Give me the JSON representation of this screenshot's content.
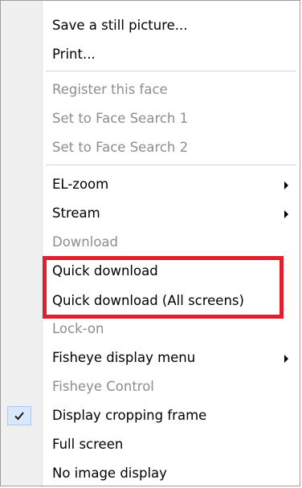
{
  "menu": {
    "items": [
      {
        "label": "Save a still picture...",
        "enabled": true
      },
      {
        "label": "Print...",
        "enabled": true
      },
      {
        "label": "Register this face",
        "enabled": false
      },
      {
        "label": "Set to Face Search 1",
        "enabled": false
      },
      {
        "label": "Set to Face Search 2",
        "enabled": false
      },
      {
        "label": "EL-zoom",
        "enabled": true,
        "submenu": true
      },
      {
        "label": "Stream",
        "enabled": true,
        "submenu": true
      },
      {
        "label": "Download",
        "enabled": false
      },
      {
        "label": "Quick download",
        "enabled": true
      },
      {
        "label": "Quick download (All screens)",
        "enabled": true
      },
      {
        "label": "Lock-on",
        "enabled": false
      },
      {
        "label": "Fisheye display menu",
        "enabled": true,
        "submenu": true
      },
      {
        "label": "Fisheye Control",
        "enabled": false
      },
      {
        "label": "Display cropping frame",
        "enabled": true,
        "checked": true
      },
      {
        "label": "Full screen",
        "enabled": true
      },
      {
        "label": "No image display",
        "enabled": true
      }
    ]
  },
  "icons": {
    "submenu": "chevron-right-icon",
    "check": "checkmark-icon"
  },
  "colors": {
    "highlight": "#e1202e",
    "disabled_text": "#8d8d8d",
    "gutter": "#f0f0f0",
    "check_background": "#d9e8fb"
  }
}
